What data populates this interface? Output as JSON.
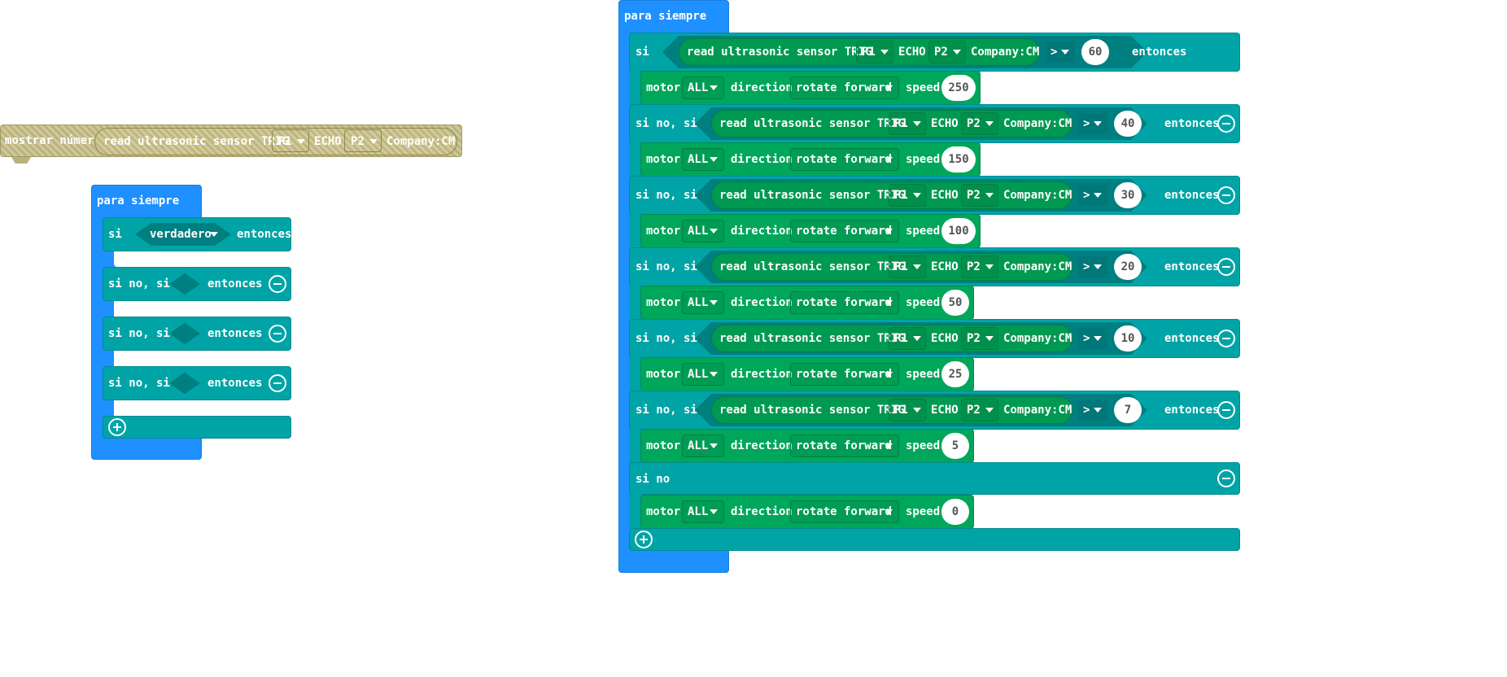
{
  "labels": {
    "forever": "para siempre",
    "if": "si",
    "elseif": "si no, si",
    "else": "si no",
    "then": "entonces",
    "true": "verdadero",
    "show_number": "mostrar número",
    "read_sensor": "read ultrasonic sensor TRIG",
    "echo": "ECHO",
    "company": "Company:CM",
    "motor": "motor",
    "direction": "direction",
    "speed": "speed",
    "pin_trig": "P1",
    "pin_echo": "P2",
    "motor_all": "ALL",
    "rotate": "rotate forward",
    "op": ">"
  },
  "thresholds": [
    "60",
    "40",
    "30",
    "20",
    "10",
    "7"
  ],
  "speeds": [
    "250",
    "150",
    "100",
    "50",
    "25",
    "5",
    "0"
  ],
  "icons": {
    "remove": "minus-circle-icon",
    "add": "plus-circle-icon",
    "dropdown": "caret-down-icon"
  },
  "colors": {
    "loops": "#1e90ff",
    "logic": "#00a4a6",
    "motor": "#00a65a",
    "sensor": "#009951",
    "disabled": "#cfc89a"
  }
}
